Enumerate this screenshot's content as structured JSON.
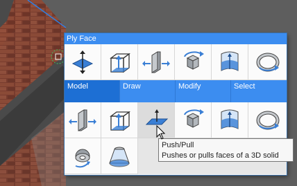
{
  "panel": {
    "title": "Ply Face"
  },
  "row1": [
    {
      "icon": "ply-face-icon"
    },
    {
      "icon": "box-with-arrow-icon"
    },
    {
      "icon": "extrude-side-icon"
    },
    {
      "icon": "revolve-icon"
    },
    {
      "icon": "sheet-face-icon"
    },
    {
      "icon": "ring-rotate-icon"
    }
  ],
  "tabs": [
    "Model",
    "Draw",
    "Modify",
    "Select"
  ],
  "row2": [
    {
      "icon": "extrude-side-icon"
    },
    {
      "icon": "box-with-arrow-icon"
    },
    {
      "icon": "push-pull-icon"
    },
    {
      "icon": "revolve-icon"
    },
    {
      "icon": "sheet-face-icon"
    },
    {
      "icon": "ring-rotate-icon"
    }
  ],
  "row3": [
    {
      "icon": "sweep-icon"
    },
    {
      "icon": "loft-icon"
    }
  ],
  "tooltip": {
    "title": "Push/Pull",
    "description": "Pushes or pulls faces of a 3D solid"
  },
  "colors": {
    "accent": "#3c8df0",
    "active_tab": "#1d6fd4",
    "icon_blue": "#3a7fd5"
  }
}
